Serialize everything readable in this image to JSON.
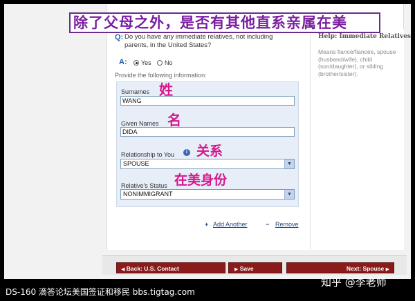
{
  "annotation": {
    "banner": "除了父母之外，是否有其他直系亲属在美",
    "surname_note": "姓",
    "given_note": "名",
    "relationship_note": "关系",
    "status_note": "在美身份"
  },
  "question": {
    "letter": "Q:",
    "text": "Do you have any immediate relatives, not including parents, in the United States?"
  },
  "help": {
    "title": "Help: Immediate Relatives",
    "text": "Means fiancé/fiancée, spouse (husband/wife), child (son/daughter), or sibling (brother/sister)."
  },
  "answer": {
    "letter": "A:",
    "options": [
      "Yes",
      "No"
    ],
    "selected": "Yes"
  },
  "provide_text": "Provide the following information:",
  "form": {
    "surnames_label": "Surnames",
    "surnames_value": "WANG",
    "given_label": "Given Names",
    "given_value": "DIDA",
    "relationship_label": "Relationship to You",
    "relationship_value": "SPOUSE",
    "status_label": "Relative's Status",
    "status_value": "NONIMMIGRANT"
  },
  "links": {
    "add": "Add Another",
    "remove": "Remove"
  },
  "nav": {
    "back": "Back: U.S. Contact",
    "save": "Save",
    "next": "Next: Spouse"
  },
  "captions": {
    "left": "DS-160  滴答论坛美国签证和移民  bbs.tigtag.com",
    "right": "知乎 @李老师"
  },
  "colors": {
    "annotation_pink": "#d6168d",
    "banner_purple": "#7a1fa0",
    "nav_button": "#8b1a1a",
    "link_blue": "#24487c"
  }
}
